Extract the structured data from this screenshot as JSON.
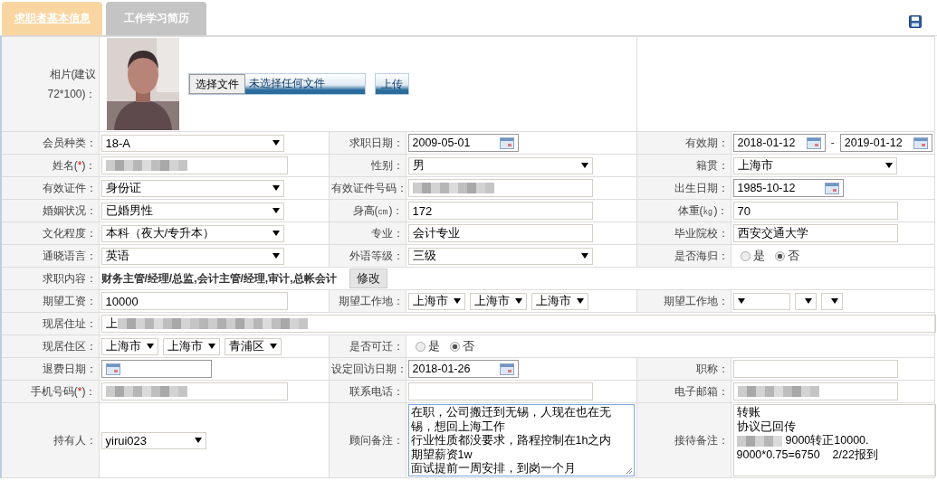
{
  "tabs": [
    {
      "label": "求职者基本信息",
      "selected": true
    },
    {
      "label": "工作学习简历",
      "selected": false
    }
  ],
  "photo_row": {
    "label": "相片(建议72*100)：",
    "file_button": "选择文件",
    "file_status": "未选择任何文件",
    "upload_button": "上传"
  },
  "rows": [
    {
      "cells": [
        {
          "label": "会员种类：",
          "field": {
            "kind": "select",
            "value": "18-A"
          }
        },
        {
          "label": "求职日期：",
          "field": {
            "kind": "date",
            "value": "2009-05-01"
          }
        },
        {
          "label": "有效期：",
          "field": {
            "kind": "date-range",
            "values": [
              "2018-01-12",
              "2019-01-12"
            ],
            "separator": "-"
          }
        }
      ]
    },
    {
      "cells": [
        {
          "label": "姓名(",
          "required_mark": "*",
          "label_end": ")：",
          "field": {
            "kind": "text",
            "blurred": true
          }
        },
        {
          "label": "性别：",
          "field": {
            "kind": "select",
            "value": "男"
          }
        },
        {
          "label": "籍贯：",
          "field": {
            "kind": "select",
            "value": "上海市"
          }
        }
      ]
    },
    {
      "cells": [
        {
          "label": "有效证件：",
          "field": {
            "kind": "select",
            "value": "身份证"
          }
        },
        {
          "label": "有效证件号码：",
          "field": {
            "kind": "text",
            "blurred": true
          }
        },
        {
          "label": "出生日期：",
          "field": {
            "kind": "date",
            "value": "1985-10-12"
          }
        }
      ]
    },
    {
      "cells": [
        {
          "label": "婚姻状况：",
          "field": {
            "kind": "select",
            "value": "已婚男性"
          }
        },
        {
          "label": "身高(㎝)：",
          "field": {
            "kind": "text",
            "value": "172"
          }
        },
        {
          "label": "体重(㎏)：",
          "field": {
            "kind": "text",
            "value": "70"
          }
        }
      ]
    },
    {
      "cells": [
        {
          "label": "文化程度：",
          "field": {
            "kind": "select",
            "value": "本科（夜大/专升本）"
          }
        },
        {
          "label": "专业：",
          "field": {
            "kind": "text",
            "value": "会计专业"
          }
        },
        {
          "label": "毕业院校：",
          "field": {
            "kind": "text",
            "value": "西安交通大学"
          }
        }
      ]
    },
    {
      "cells": [
        {
          "label": "通晓语言：",
          "field": {
            "kind": "select",
            "value": "英语"
          }
        },
        {
          "label": "外语等级：",
          "field": {
            "kind": "select",
            "value": "三级"
          }
        },
        {
          "label": "是否海归：",
          "field": {
            "kind": "radio",
            "options": [
              {
                "label": "是",
                "selected": false
              },
              {
                "label": "否",
                "selected": true
              }
            ]
          }
        }
      ]
    },
    {
      "cells": [
        {
          "label": "求职内容：",
          "wide": true,
          "field": {
            "kind": "job-content",
            "text": "财务主管/经理/总监,会计主管/经理,审计,总帐会计",
            "button": "修改"
          }
        }
      ]
    },
    {
      "cells": [
        {
          "label": "期望工资：",
          "field": {
            "kind": "text",
            "value": "10000"
          }
        },
        {
          "label": "期望工作地：",
          "field": {
            "kind": "selects",
            "items": [
              {
                "kind": "medium",
                "value": "上海市"
              },
              {
                "kind": "medium",
                "value": "上海市"
              },
              {
                "kind": "medium",
                "value": "上海市"
              }
            ]
          }
        },
        {
          "label": "期望工作地：",
          "field": {
            "kind": "selects",
            "items": [
              {
                "kind": "medium"
              },
              {
                "kind": "small"
              },
              {
                "kind": "small"
              }
            ]
          }
        }
      ]
    },
    {
      "cells": [
        {
          "label": "现居住址：",
          "wide": true,
          "field": {
            "kind": "text",
            "value": "上",
            "blurred": true
          }
        }
      ]
    },
    {
      "cells": [
        {
          "label": "现居住区：",
          "field": {
            "kind": "selects",
            "items": [
              {
                "kind": "medium",
                "value": "上海市"
              },
              {
                "kind": "medium",
                "value": "上海市"
              },
              {
                "kind": "medium",
                "value": "青浦区"
              }
            ]
          }
        },
        {
          "label": "是否可迁：",
          "wide": true,
          "field": {
            "kind": "radio",
            "options": [
              {
                "label": "是",
                "selected": false
              },
              {
                "label": "否",
                "selected": true
              }
            ]
          }
        }
      ]
    },
    {
      "cells": [
        {
          "label": "退费日期：",
          "field": {
            "kind": "date"
          }
        },
        {
          "label": "设定回访日期：",
          "field": {
            "kind": "date",
            "value": "2018-01-26"
          }
        },
        {
          "label": "职称：",
          "field": {
            "kind": "text"
          }
        }
      ]
    },
    {
      "cells": [
        {
          "label": "手机号码(",
          "required_mark": "*",
          "label_end": ")：",
          "field": {
            "kind": "text",
            "blurred": true
          }
        },
        {
          "label": "联系电话：",
          "field": {
            "kind": "text"
          }
        },
        {
          "label": "电子邮箱：",
          "field": {
            "kind": "text",
            "blurred": true
          }
        }
      ]
    },
    {
      "cells": [
        {
          "label": "持有人：",
          "field": {
            "kind": "select",
            "value": "yirui023",
            "compact": true
          }
        },
        {
          "label": "顾问备注：",
          "field": {
            "kind": "textarea",
            "lines": [
              "在职，公司搬迁到无锡，人现在也在无锡，想回上海工作",
              "行业性质都没要求，路程控制在1h之内",
              "期望薪资1w",
              "面试提前一周安排，到岗一个月"
            ]
          }
        },
        {
          "label": "接待备注：",
          "field": {
            "kind": "note",
            "lines": [
              {
                "text": "转账"
              },
              {
                "text": "协议已回传"
              },
              {
                "text": "9000转正10000.",
                "blurred": true
              },
              {
                "text": "9000*0.75=6750    2/22报到"
              }
            ]
          }
        }
      ]
    }
  ]
}
